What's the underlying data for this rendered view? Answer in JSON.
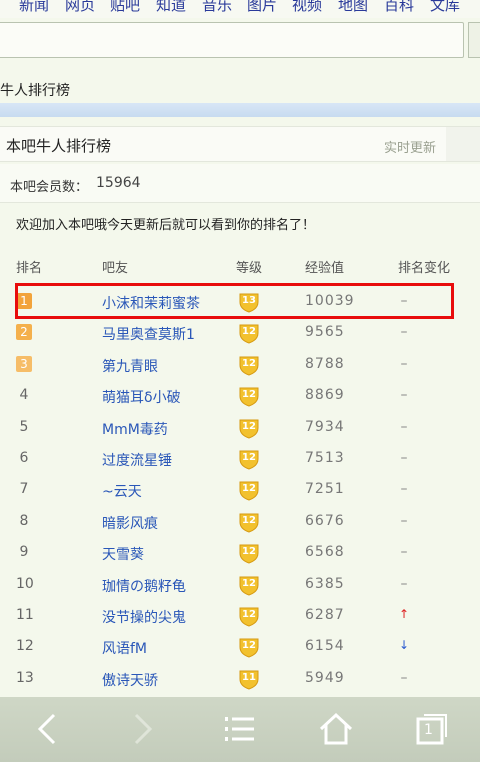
{
  "nav": [
    "新闻",
    "网页",
    "贴吧",
    "知道",
    "音乐",
    "图片",
    "视频",
    "地图",
    "百科",
    "文库"
  ],
  "search": {
    "value": ""
  },
  "breadcrumb": "牛人排行榜",
  "section": {
    "title": "本吧牛人排行榜",
    "realtime": "实时更新"
  },
  "member": {
    "label": "本吧会员数：",
    "count": "15964"
  },
  "welcome": "欢迎加入本吧哦今天更新后就可以看到你的排名了！",
  "columns": {
    "rank": "排名",
    "name": "吧友",
    "level": "等级",
    "exp": "经验值",
    "change": "排名变化"
  },
  "rows": [
    {
      "rank": "1",
      "name": "小沫和茉莉蜜茶",
      "level": "13",
      "exp": "10039",
      "change": "–"
    },
    {
      "rank": "2",
      "name": "马里奥查莫斯1",
      "level": "12",
      "exp": "9565",
      "change": "–"
    },
    {
      "rank": "3",
      "name": "第九青眼",
      "level": "12",
      "exp": "8788",
      "change": "–"
    },
    {
      "rank": "4",
      "name": "萌猫耳δ小破",
      "level": "12",
      "exp": "8869",
      "change": "–"
    },
    {
      "rank": "5",
      "name": "MmM毒药",
      "level": "12",
      "exp": "7934",
      "change": "–"
    },
    {
      "rank": "6",
      "name": "过度流星锤",
      "level": "12",
      "exp": "7513",
      "change": "–"
    },
    {
      "rank": "7",
      "name": "~云天",
      "level": "12",
      "exp": "7251",
      "change": "–"
    },
    {
      "rank": "8",
      "name": "暗影风痕",
      "level": "12",
      "exp": "6676",
      "change": "–"
    },
    {
      "rank": "9",
      "name": "天雪葵",
      "level": "12",
      "exp": "6568",
      "change": "–"
    },
    {
      "rank": "10",
      "name": "珈情の鹅籽龟",
      "level": "12",
      "exp": "6385",
      "change": "–"
    },
    {
      "rank": "11",
      "name": "没节操的尖鬼",
      "level": "12",
      "exp": "6287",
      "change": "↑"
    },
    {
      "rank": "12",
      "name": "风语fM",
      "level": "12",
      "exp": "6154",
      "change": "↓"
    },
    {
      "rank": "13",
      "name": "傲诗天骄",
      "level": "11",
      "exp": "5949",
      "change": "–"
    }
  ],
  "colors": {
    "top1": "#f2a33a",
    "top2": "#f4b04c",
    "top3": "#f6bd68",
    "highlight": "#e80c0c",
    "link": "#2a57b8"
  },
  "bottombar": {
    "tabs_count": "1"
  }
}
